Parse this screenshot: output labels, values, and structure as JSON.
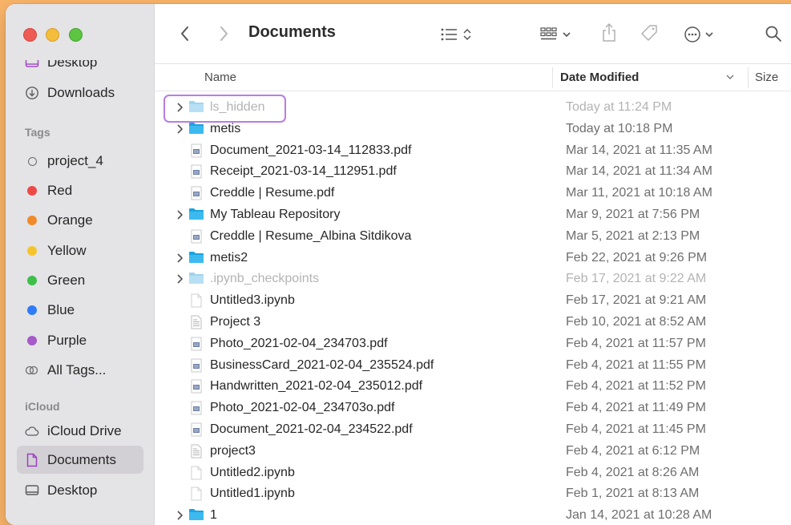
{
  "window": {
    "title": "Documents"
  },
  "sidebar": {
    "top_items": [
      {
        "label": "Desktop",
        "icon": "desktop-icon"
      },
      {
        "label": "Downloads",
        "icon": "downloads-icon"
      }
    ],
    "tags_header": "Tags",
    "tags": [
      {
        "label": "project_4",
        "color": ""
      },
      {
        "label": "Red",
        "color": "#ed4a47"
      },
      {
        "label": "Orange",
        "color": "#f08a2b"
      },
      {
        "label": "Yellow",
        "color": "#f5c42d"
      },
      {
        "label": "Green",
        "color": "#3dbf4a"
      },
      {
        "label": "Blue",
        "color": "#2f7cf6"
      },
      {
        "label": "Purple",
        "color": "#a55ac8"
      },
      {
        "label": "All Tags...",
        "color": ""
      }
    ],
    "icloud_header": "iCloud",
    "icloud_items": [
      {
        "label": "iCloud Drive",
        "icon": "cloud-icon"
      },
      {
        "label": "Documents",
        "icon": "document-icon",
        "selected": true
      },
      {
        "label": "Desktop",
        "icon": "desktop-icon"
      }
    ]
  },
  "columns": {
    "name": "Name",
    "date": "Date Modified",
    "size": "Size"
  },
  "files": [
    {
      "name": "ls_hidden",
      "date": "Today at 11:24 PM",
      "kind": "folder",
      "expand": true,
      "dim": true
    },
    {
      "name": "metis",
      "date": "Today at 10:18 PM",
      "kind": "folder",
      "expand": true
    },
    {
      "name": "Document_2021-03-14_112833.pdf",
      "date": "Mar 14, 2021 at 11:35 AM",
      "kind": "pdf"
    },
    {
      "name": "Receipt_2021-03-14_112951.pdf",
      "date": "Mar 14, 2021 at 11:34 AM",
      "kind": "pdf"
    },
    {
      "name": "Creddle | Resume.pdf",
      "date": "Mar 11, 2021 at 10:18 AM",
      "kind": "pdf"
    },
    {
      "name": "My Tableau Repository",
      "date": "Mar 9, 2021 at 7:56 PM",
      "kind": "folder",
      "expand": true
    },
    {
      "name": "Creddle | Resume_Albina Sitdikova",
      "date": "Mar 5, 2021 at 2:13 PM",
      "kind": "pdf"
    },
    {
      "name": "metis2",
      "date": "Feb 22, 2021 at 9:26 PM",
      "kind": "folder",
      "expand": true
    },
    {
      "name": ".ipynb_checkpoints",
      "date": "Feb 17, 2021 at 9:22 AM",
      "kind": "folder",
      "expand": true,
      "dim": true
    },
    {
      "name": "Untitled3.ipynb",
      "date": "Feb 17, 2021 at 9:21 AM",
      "kind": "blank"
    },
    {
      "name": "Project 3",
      "date": "Feb 10, 2021 at 8:52 AM",
      "kind": "text"
    },
    {
      "name": "Photo_2021-02-04_234703.pdf",
      "date": "Feb 4, 2021 at 11:57 PM",
      "kind": "pdf"
    },
    {
      "name": "BusinessCard_2021-02-04_235524.pdf",
      "date": "Feb 4, 2021 at 11:55 PM",
      "kind": "pdf"
    },
    {
      "name": "Handwritten_2021-02-04_235012.pdf",
      "date": "Feb 4, 2021 at 11:52 PM",
      "kind": "pdf"
    },
    {
      "name": "Photo_2021-02-04_234703o.pdf",
      "date": "Feb 4, 2021 at 11:49 PM",
      "kind": "pdf"
    },
    {
      "name": "Document_2021-02-04_234522.pdf",
      "date": "Feb 4, 2021 at 11:45 PM",
      "kind": "pdf"
    },
    {
      "name": "project3",
      "date": "Feb 4, 2021 at 6:12 PM",
      "kind": "text"
    },
    {
      "name": "Untitled2.ipynb",
      "date": "Feb 4, 2021 at 8:26 AM",
      "kind": "blank"
    },
    {
      "name": "Untitled1.ipynb",
      "date": "Feb 1, 2021 at 8:13 AM",
      "kind": "blank"
    },
    {
      "name": "1",
      "date": "Jan 14, 2021 at 10:28 AM",
      "kind": "folder",
      "expand": true
    }
  ],
  "toolbar_icons": [
    "back-icon",
    "forward-icon",
    "list-view-icon",
    "group-icon",
    "share-icon",
    "tag-icon",
    "more-icon",
    "search-icon"
  ]
}
